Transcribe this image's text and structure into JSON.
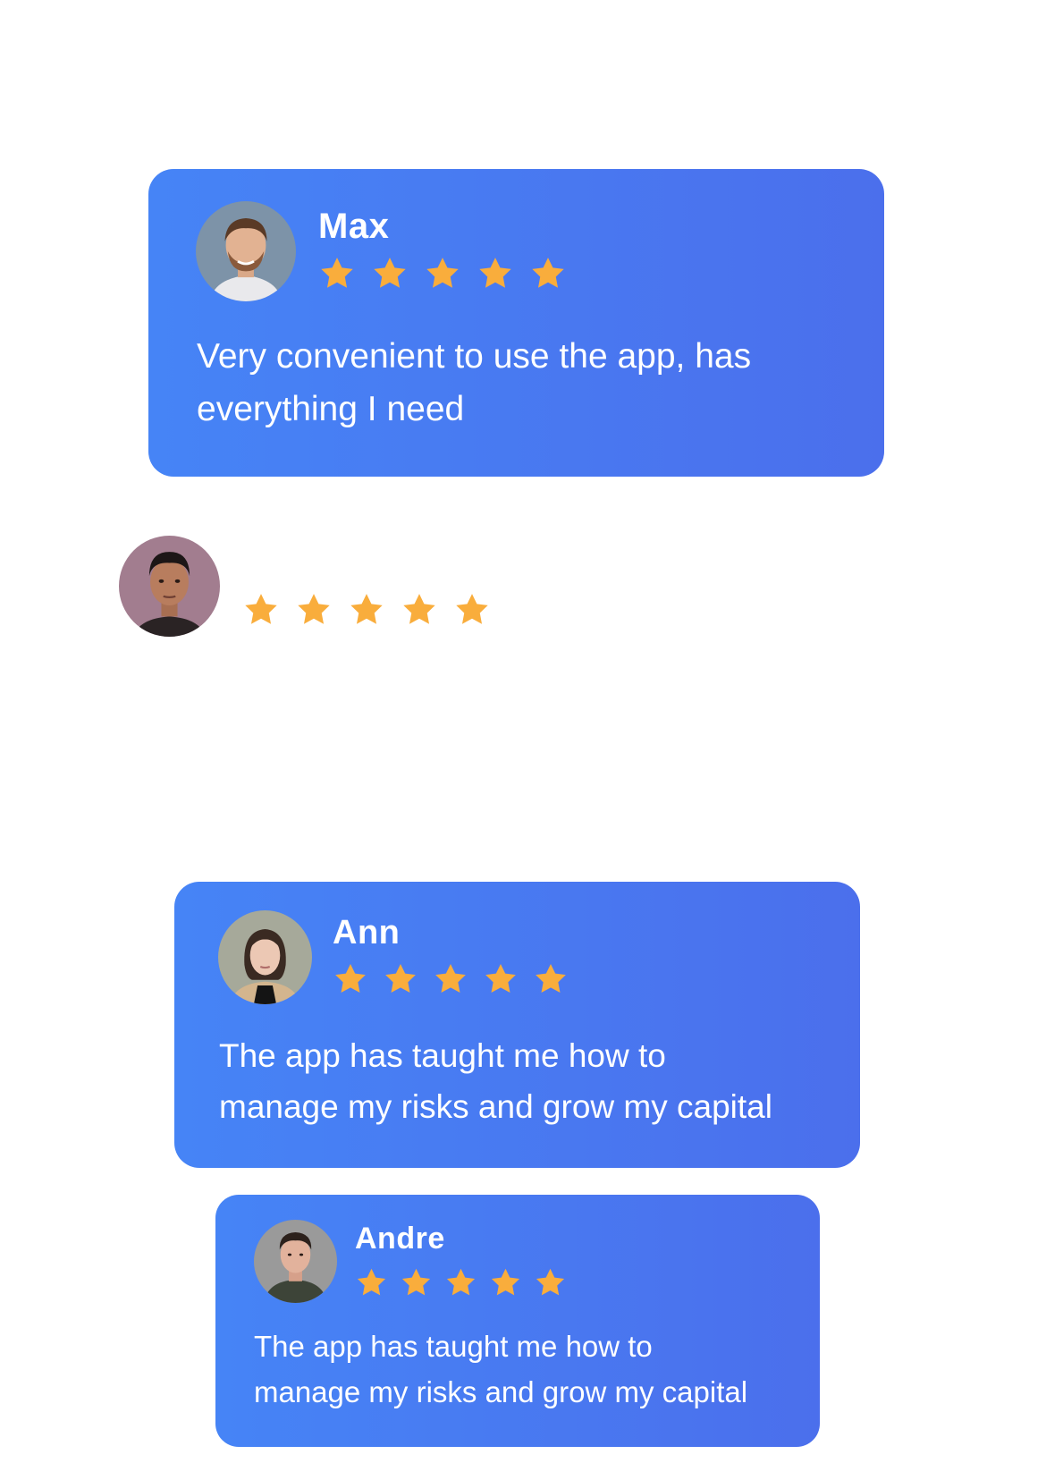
{
  "colors": {
    "card_gradient_start": "#4684f6",
    "card_gradient_end": "#4b6fec",
    "star": "#f9ad3c",
    "text": "#ffffff"
  },
  "reviews": [
    {
      "name": "Max",
      "rating": 5,
      "text_line1": "Very convenient to use the app, has",
      "text_line2": "everything I need",
      "avatar_icon": "man-portrait-avatar"
    },
    {
      "name": "",
      "rating": 5,
      "avatar_icon": "man-portrait-avatar"
    },
    {
      "name": "Ann",
      "rating": 5,
      "text_line1": "The app has taught me how to",
      "text_line2": "manage  my risks and grow my capital",
      "avatar_icon": "woman-portrait-avatar"
    },
    {
      "name": "Andre",
      "rating": 5,
      "text_line1": "The app has taught me how to",
      "text_line2": "manage  my risks and grow my capital",
      "avatar_icon": "man-portrait-avatar"
    }
  ]
}
